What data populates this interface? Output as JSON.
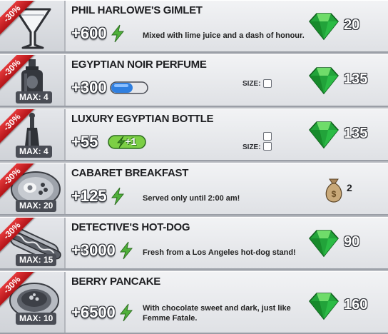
{
  "colors": {
    "ribbon": "#c8191d",
    "gem": "#22a33a",
    "energy": "#4fb03a",
    "row_bg": "#e8e9ec"
  },
  "items": [
    {
      "discount": "-30%",
      "title": "PHIL HARLOWE'S GIMLET",
      "value": "+600",
      "value_icon": "energy-bolt-icon",
      "description": "Mixed with lime juice and a dash of honour.",
      "price": "20",
      "currency_icon": "gem-icon",
      "image_icon": "martini-glass-icon"
    },
    {
      "discount": "-30%",
      "max": "MAX: 4",
      "title": "EGYPTIAN NOIR PERFUME",
      "value": "+300",
      "value_icon": "blue-capsule-icon",
      "size_label": "SIZE:",
      "size_slots": 1,
      "price": "135",
      "currency_icon": "gem-icon",
      "image_icon": "perfume-bottle-icon"
    },
    {
      "discount": "-30%",
      "max": "MAX: 4",
      "title": "LUXURY EGYPTIAN BOTTLE",
      "value": "+55",
      "value_icon": "energy-plus-one-pill-icon",
      "pill_text": "+1",
      "size_label": "SIZE:",
      "size_slots": 2,
      "price": "135",
      "currency_icon": "gem-icon",
      "image_icon": "bottle-icon"
    },
    {
      "discount": "-30%",
      "max": "MAX: 20",
      "title": "CABARET BREAKFAST",
      "value": "+125",
      "value_icon": "energy-bolt-icon",
      "description": "Served only until 2:00 am!",
      "price": "2",
      "currency_icon": "money-bag-icon",
      "image_icon": "breakfast-plate-icon"
    },
    {
      "discount": "-30%",
      "max": "MAX: 15",
      "title": "DETECTIVE'S HOT-DOG",
      "value": "+3000",
      "value_icon": "energy-bolt-icon",
      "description": "Fresh from a Los Angeles hot-dog stand!",
      "price": "90",
      "currency_icon": "gem-icon",
      "image_icon": "hot-dog-icon"
    },
    {
      "discount": "-30%",
      "max": "MAX: 10",
      "title": "BERRY PANCAKE",
      "value": "+6500",
      "value_icon": "energy-bolt-icon",
      "description_lines": [
        "With chocolate sweet and dark, just like",
        "Femme Fatale."
      ],
      "price": "160",
      "currency_icon": "gem-icon",
      "image_icon": "pancake-plate-icon"
    }
  ]
}
